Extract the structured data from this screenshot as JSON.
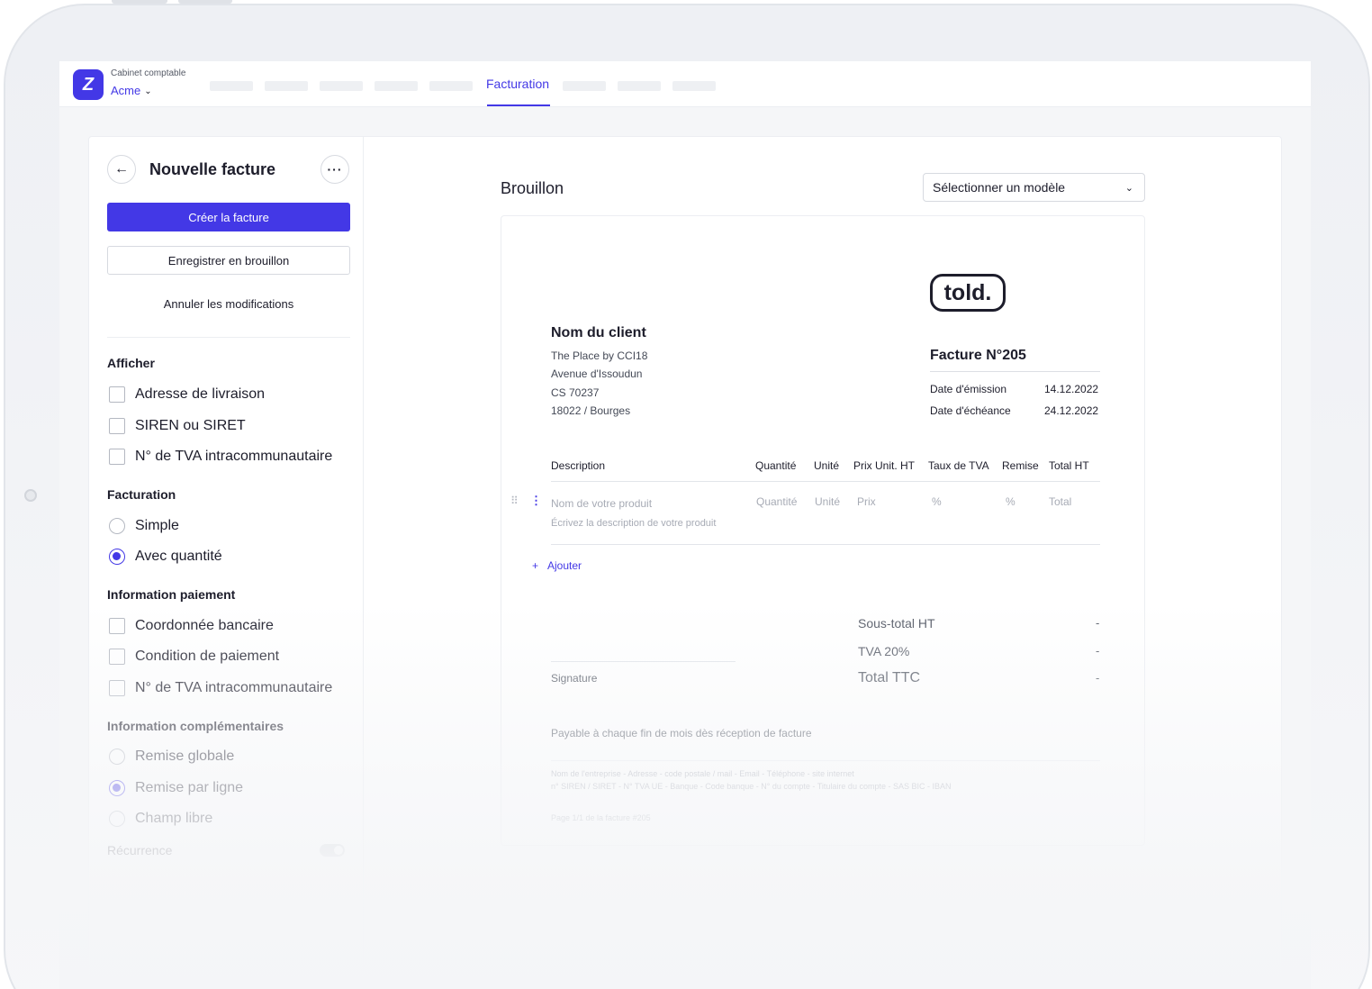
{
  "colors": {
    "accent": "#4338e6",
    "text": "#1d1d2b",
    "muted": "#a7abb5",
    "border": "#d7dae0"
  },
  "topbar": {
    "logo_icon": "z-logo-icon",
    "org_subtitle": "Cabinet comptable",
    "org_name": "Acme",
    "active_tab": "Facturation"
  },
  "sidebar": {
    "title": "Nouvelle facture",
    "back_icon": "arrow-left-icon",
    "more_icon": "more-horizontal-icon",
    "create_label": "Créer la facture",
    "draft_label": "Enregistrer en brouillon",
    "cancel_label": "Annuler les modifications",
    "sections": {
      "afficher": {
        "title": "Afficher",
        "options": [
          "Adresse de livraison",
          "SIREN ou SIRET",
          "N° de TVA intracommunautaire"
        ]
      },
      "facturation": {
        "title": "Facturation",
        "options": [
          "Simple",
          "Avec quantité"
        ],
        "selected": "Avec quantité"
      },
      "paiement": {
        "title": "Information paiement",
        "options": [
          "Coordonnée bancaire",
          "Condition de paiement",
          "N° de TVA intracommunautaire"
        ]
      },
      "complementaires": {
        "title": "Information complémentaires",
        "options": [
          "Remise globale",
          "Remise par ligne",
          "Champ libre"
        ],
        "selected": "Remise par ligne"
      }
    },
    "recurrence_label": "Récurrence"
  },
  "main": {
    "title": "Brouillon",
    "template_select": "Sélectionner un modèle"
  },
  "invoice": {
    "brand": "told.",
    "client": {
      "name": "Nom du client",
      "lines": [
        "The Place by CCI18",
        "Avenue d'Issoudun",
        "CS 70237",
        "18022 / Bourges"
      ]
    },
    "number": "Facture N°205",
    "issue_label": "Date d'émission",
    "issue_date": "14.12.2022",
    "due_label": "Date d'échéance",
    "due_date": "24.12.2022",
    "columns": [
      "Description",
      "Quantité",
      "Unité",
      "Prix Unit. HT",
      "Taux de TVA",
      "Remise",
      "Total HT"
    ],
    "row_placeholders": {
      "name": "Nom de votre produit",
      "description": "Écrivez la description de votre produit",
      "quantity": "Quantité",
      "unit": "Unité",
      "price": "Prix",
      "vat": "%",
      "discount": "%",
      "total": "Total"
    },
    "add_label": "Ajouter",
    "subtotal_label": "Sous-total HT",
    "subtotal_value": "-",
    "vat_label": "TVA 20%",
    "vat_value": "-",
    "total_label": "Total TTC",
    "total_value": "-",
    "signature_label": "Signature",
    "payment_note": "Payable à chaque fin de mois dès réception de facture",
    "footer_line1": "Nom de l'entreprise - Adresse - code postale / mail - Email - Téléphone - site internet",
    "footer_line2": "n° SIREN / SIRET - N° TVA UE - Banque - Code banque - N° du compte - Titulaire du compte - SAS BIC - IBAN",
    "page_note": "Page 1/1 de la facture #205"
  }
}
